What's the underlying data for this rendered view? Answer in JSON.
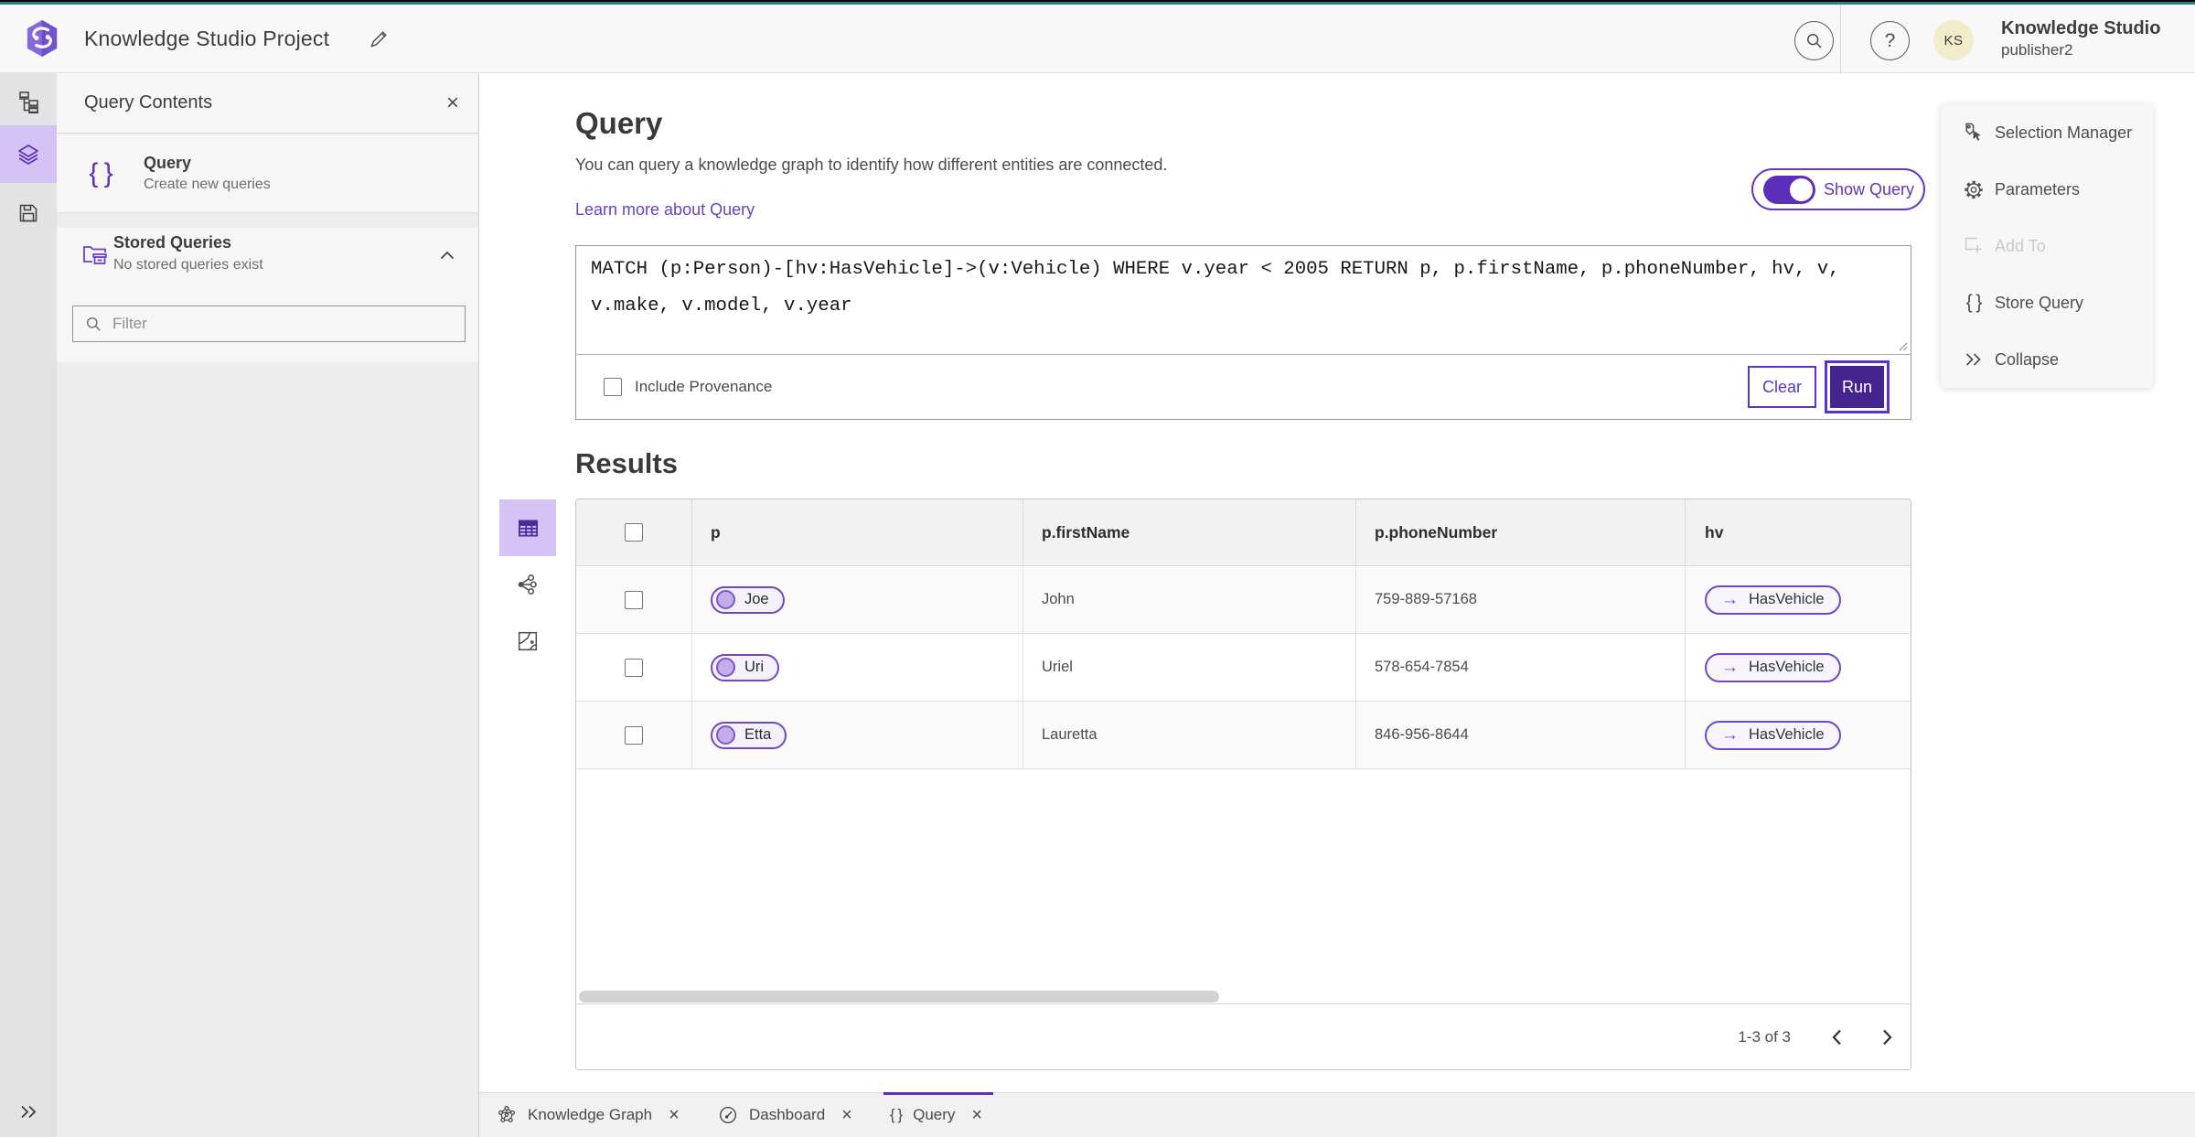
{
  "header": {
    "title": "Knowledge Studio Project",
    "user_org": "Knowledge Studio",
    "user_name": "publisher2",
    "avatar_initials": "KS"
  },
  "icons": {
    "close": "×",
    "braces": "{ }",
    "question": "?",
    "arrow_right": "→"
  },
  "sidebar": {
    "title": "Query Contents",
    "query_item": {
      "title": "Query",
      "subtitle": "Create new queries"
    },
    "stored_item": {
      "title": "Stored Queries",
      "subtitle": "No stored queries exist"
    },
    "filter_placeholder": "Filter"
  },
  "query_panel": {
    "title": "Query",
    "description": "You can query a knowledge graph to identify how different entities are connected.",
    "learn_more": "Learn more about Query",
    "show_query_label": "Show Query",
    "show_query_on": true,
    "query_text": "MATCH (p:Person)-[hv:HasVehicle]->(v:Vehicle) WHERE v.year < 2005 RETURN p, p.firstName, p.phoneNumber, hv, v, v.make, v.model, v.year",
    "include_provenance_label": "Include Provenance",
    "clear_label": "Clear",
    "run_label": "Run"
  },
  "results": {
    "title": "Results",
    "columns": [
      "p",
      "p.firstName",
      "p.phoneNumber",
      "hv"
    ],
    "rows": [
      {
        "entity": "Joe",
        "first_name": "John",
        "phone": "759-889-57168",
        "relationship": "HasVehicle"
      },
      {
        "entity": "Uri",
        "first_name": "Uriel",
        "phone": "578-654-7854",
        "relationship": "HasVehicle"
      },
      {
        "entity": "Etta",
        "first_name": "Lauretta",
        "phone": "846-956-8644",
        "relationship": "HasVehicle"
      }
    ],
    "pagination": "1-3 of 3"
  },
  "context_menu": {
    "items": [
      {
        "label": "Selection Manager"
      },
      {
        "label": "Parameters"
      },
      {
        "label": "Add To"
      },
      {
        "label": "Store Query"
      },
      {
        "label": "Collapse"
      }
    ]
  },
  "tabs": {
    "items": [
      {
        "label": "Knowledge Graph"
      },
      {
        "label": "Dashboard"
      },
      {
        "label": "Query"
      }
    ]
  },
  "colors": {
    "brand_teal": "#2e8080",
    "accent_purple": "#5e2fbe",
    "accent_purple_light": "#d5c3f6",
    "run_fill": "#46248f",
    "link": "#6742c6"
  }
}
